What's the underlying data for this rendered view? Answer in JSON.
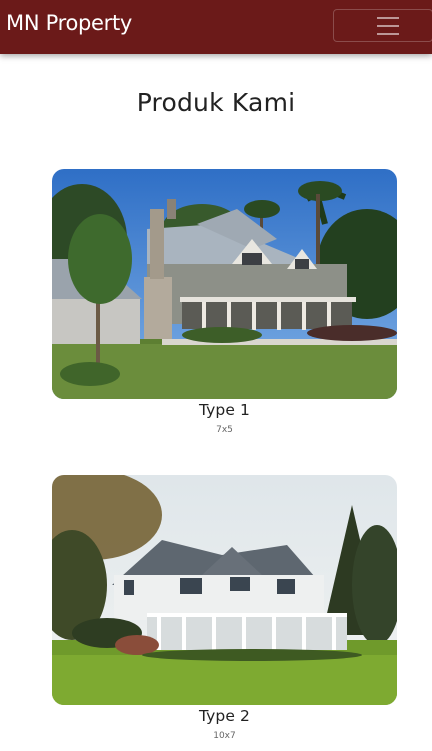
{
  "navbar": {
    "brand": "MN Property",
    "colors": {
      "background": "#6b1a19",
      "text": "#ffffff"
    },
    "toggler_icon": "hamburger-menu-icon"
  },
  "page": {
    "title": "Produk Kami"
  },
  "products": [
    {
      "name": "Type 1",
      "size": "7x5",
      "image": "house-photo-gray-cottage-palms"
    },
    {
      "name": "Type 2",
      "size": "10x7",
      "image": "house-photo-white-porch-lawn"
    }
  ]
}
